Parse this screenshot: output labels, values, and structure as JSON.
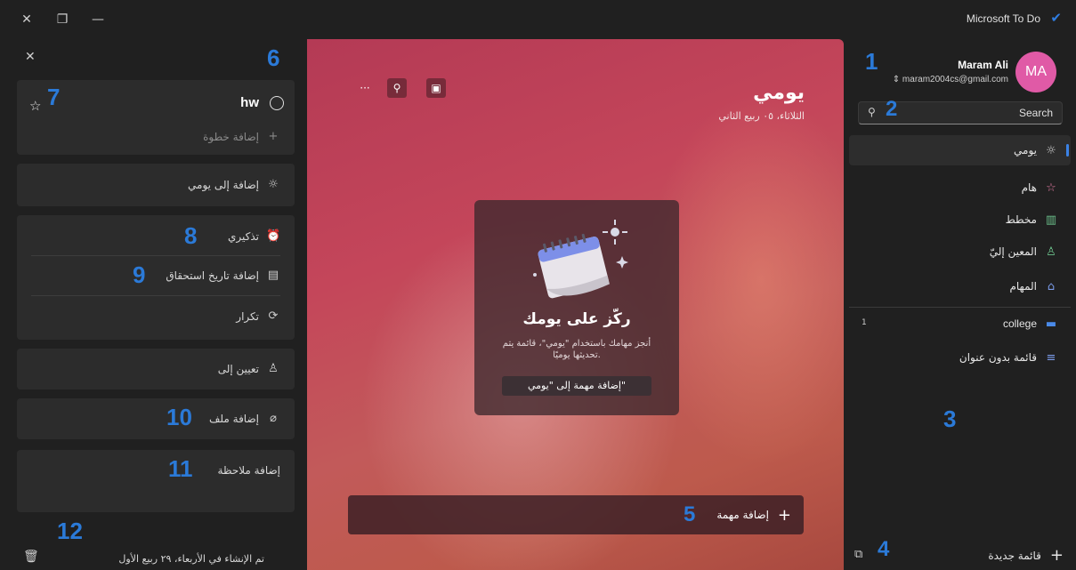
{
  "titlebar": {
    "close": "✕",
    "restore": "❐",
    "minimize": "—",
    "app_name": "Microsoft To Do",
    "check": "✔"
  },
  "detail": {
    "close": "✕",
    "task_title": "hw",
    "add_step": "إضافة خطوة",
    "add_to_myday": "إضافة إلى يومي",
    "remind_me": "تذكيري",
    "add_due_date": "إضافة تاريخ استحقاق",
    "repeat": "تكرار",
    "assign_to": "تعيين إلى",
    "add_file": "إضافة ملف",
    "add_note": "إضافة ملاحظة",
    "created_on": "تم الإنشاء في الأربعاء، ٢٩ ربيع الأول"
  },
  "center": {
    "title": "يومي",
    "date": "الثلاثاء، ٠٥ ربيع الثاني",
    "more": "···",
    "focus_title": "ركّز على يومك",
    "focus_desc": "أنجز مهامك باستخدام \"يومي\"، قائمة يتم تحديثها يوميًا.",
    "focus_button": "إضافة مهمة إلى \"يومي\"",
    "add_task": "إضافة مهمة"
  },
  "sidebar": {
    "avatar": "MA",
    "user_name": "Maram Ali",
    "user_email": "maram2004cs@gmail.com",
    "search_placeholder": "Search",
    "nav": [
      {
        "label": "يومي",
        "icon": "☼"
      },
      {
        "label": "هام",
        "icon": "☆"
      },
      {
        "label": "مخطط",
        "icon": "▥"
      },
      {
        "label": "المعين إليّ",
        "icon": "♙"
      },
      {
        "label": "المهام",
        "icon": "⌂"
      }
    ],
    "lists": [
      {
        "label": "college",
        "icon": "▬",
        "count": "1"
      },
      {
        "label": "قائمة بدون عنوان",
        "icon": "≡"
      }
    ],
    "new_list": "قائمة جديدة"
  },
  "annotations": [
    "1",
    "2",
    "3",
    "4",
    "5",
    "6",
    "7",
    "8",
    "9",
    "10",
    "11",
    "12"
  ],
  "colors": {
    "accent": "#2b7ad8",
    "avatar": "#e05aa6",
    "background": "#202020"
  }
}
